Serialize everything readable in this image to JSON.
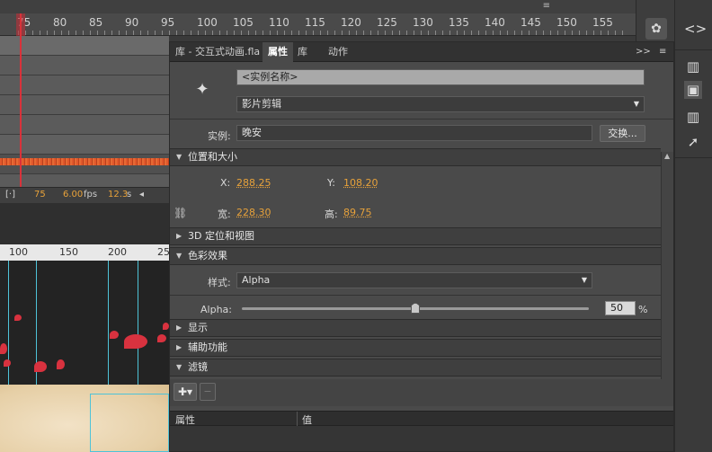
{
  "timeline": {
    "ruler_numbers": [
      "75",
      "80",
      "85",
      "90",
      "95",
      "100",
      "105",
      "110",
      "115",
      "120",
      "125",
      "130",
      "135",
      "140",
      "145",
      "150",
      "155"
    ],
    "status": {
      "frame": "75",
      "fps": "6.00",
      "fps_unit": "fps",
      "time": "12.3",
      "time_unit": "s"
    },
    "menu_glyph": "≡"
  },
  "stage": {
    "ruler_numbers": [
      "100",
      "150",
      "200",
      "25"
    ]
  },
  "panel": {
    "tabs": [
      "库 - 交互式动画.fla",
      "属性",
      "库",
      "动作"
    ],
    "tab_controls": ">>",
    "instance_name_placeholder": "<实例名称>",
    "symbol_type": "影片剪辑",
    "instance_label": "实例:",
    "instance_value": "晚安",
    "swap_button": "交换...",
    "sections": {
      "position": "位置和大小",
      "three_d": "3D 定位和视图",
      "color": "色彩效果",
      "display": "显示",
      "accessibility": "辅助功能",
      "filters": "滤镜"
    },
    "position": {
      "x_label": "X:",
      "x_value": "288.25",
      "y_label": "Y:",
      "y_value": "108.20",
      "w_label": "宽:",
      "w_value": "228.30",
      "h_label": "高:",
      "h_value": "89.75"
    },
    "color_effect": {
      "style_label": "样式:",
      "style_value": "Alpha",
      "alpha_label": "Alpha:",
      "alpha_value": "50",
      "alpha_unit": "%",
      "alpha_level": 0.5
    },
    "filter_table": {
      "col1": "属性",
      "col2": "值"
    }
  },
  "colors": {
    "accent": "#e8a23a",
    "playhead": "#d9323a",
    "wave": "#e0582c",
    "guide": "#4ec3d8"
  }
}
